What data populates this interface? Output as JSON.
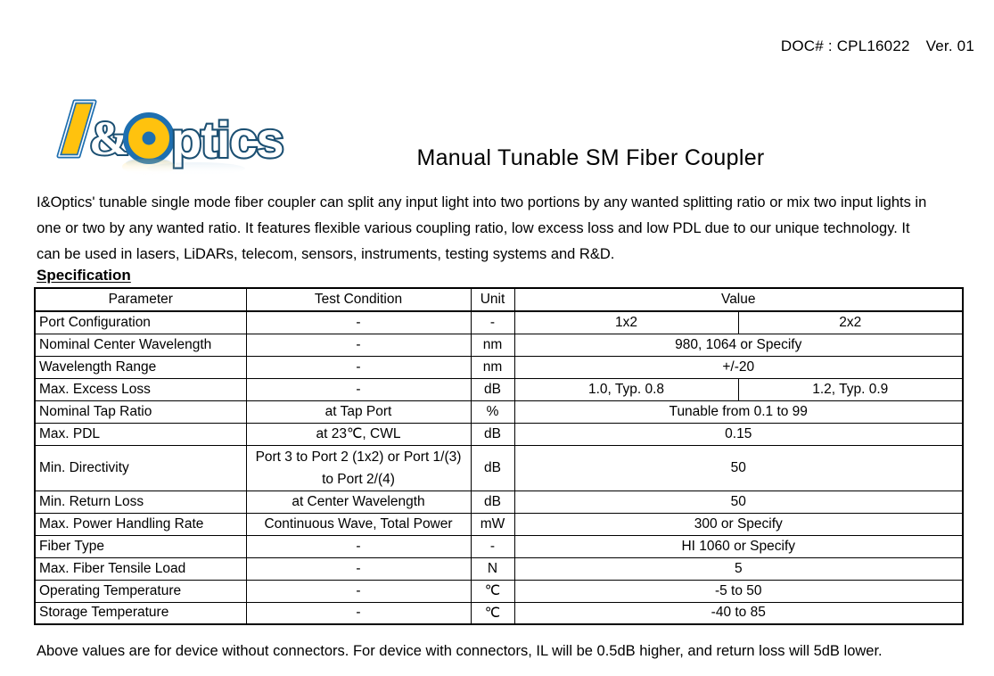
{
  "header": {
    "doc_number": "DOC# : CPL16022",
    "version": "Ver. 01"
  },
  "logo": {
    "alt": "I&Optics",
    "letter_i": "I",
    "ampersand": "&",
    "letter_o": "O",
    "word_rest": "ptics",
    "yellow": "#FFC20E",
    "blue": "#1E6FB0",
    "dark_blue": "#1B4F72"
  },
  "title": "Manual Tunable SM Fiber Coupler",
  "intro": "I&Optics' tunable single mode fiber coupler can split any input light into two portions by any wanted splitting ratio or mix two input lights in one or two by any wanted ratio. It features flexible various coupling ratio, low excess loss and low PDL due to our unique technology. It can be used in lasers, LiDARs, telecom, sensors, instruments, testing systems and R&D.",
  "spec_heading": "Specification",
  "table": {
    "columns": [
      "Parameter",
      "Test Condition",
      "Unit",
      "Value"
    ],
    "rows": [
      {
        "parameter": "Port Configuration",
        "test_condition": "-",
        "unit": "-",
        "value_left": "1x2",
        "value_right": "2x2",
        "split": true
      },
      {
        "parameter": "Nominal Center Wavelength",
        "test_condition": "-",
        "unit": "nm",
        "value": "980, 1064 or Specify",
        "split": false
      },
      {
        "parameter": "Wavelength Range",
        "test_condition": "-",
        "unit": "nm",
        "value": "+/-20",
        "split": false
      },
      {
        "parameter": "Max. Excess Loss",
        "test_condition": "-",
        "unit": "dB",
        "value_left": "1.0, Typ. 0.8",
        "value_right": "1.2, Typ. 0.9",
        "split": true
      },
      {
        "parameter": "Nominal Tap Ratio",
        "test_condition": "at Tap Port",
        "unit": "%",
        "value": "Tunable from 0.1 to 99",
        "split": false
      },
      {
        "parameter": "Max. PDL",
        "test_condition": "at 23℃, CWL",
        "unit": "dB",
        "value": "0.15",
        "split": false
      },
      {
        "parameter": "Min. Directivity",
        "test_condition": "Port 3 to Port 2 (1x2) or Port 1/(3) to Port 2/(4)",
        "unit": "dB",
        "value": "50",
        "split": false,
        "tall": true
      },
      {
        "parameter": "Min. Return Loss",
        "test_condition": "at Center Wavelength",
        "unit": "dB",
        "value": "50",
        "split": false
      },
      {
        "parameter": "Max. Power Handling Rate",
        "test_condition": "Continuous Wave, Total Power",
        "unit": "mW",
        "value": "300 or Specify",
        "split": false
      },
      {
        "parameter": "Fiber Type",
        "test_condition": "-",
        "unit": "-",
        "value": "HI 1060 or Specify",
        "split": false
      },
      {
        "parameter": "Max. Fiber Tensile Load",
        "test_condition": "-",
        "unit": "N",
        "value": "5",
        "split": false
      },
      {
        "parameter": "Operating Temperature",
        "test_condition": "-",
        "unit": "℃",
        "value": "-5 to 50",
        "split": false
      },
      {
        "parameter": "Storage Temperature",
        "test_condition": "-",
        "unit": "℃",
        "value": "-40 to 85",
        "split": false
      }
    ]
  },
  "footnote": "Above values are for device without connectors. For device with connectors, IL will be 0.5dB higher,  and return loss will 5dB lower."
}
